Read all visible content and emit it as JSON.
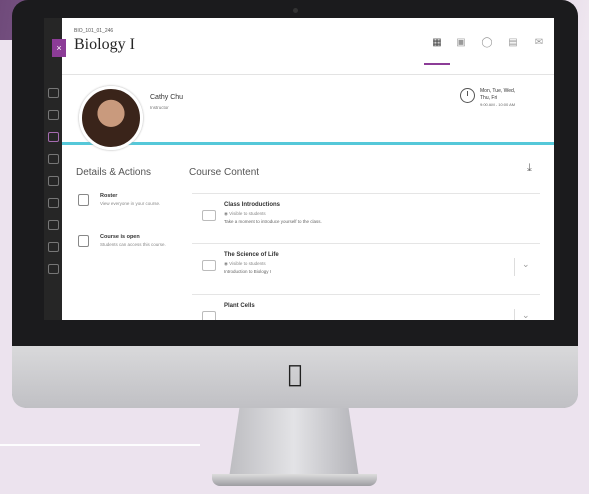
{
  "course": {
    "id": "BIO_101_01_246",
    "title": "Biology I"
  },
  "nav": {
    "close_label": "×"
  },
  "header_icons": [
    "book-icon",
    "calendar-icon",
    "chat-icon",
    "grades-icon",
    "messages-icon"
  ],
  "instructor": {
    "name": "Cathy Chu",
    "role": "Instructor"
  },
  "schedule": {
    "days_line1": "Mon, Tue, Wed,",
    "days_line2": "Thu, Fri",
    "time": "9:00 AM - 10:00 AM"
  },
  "details": {
    "title": "Details & Actions",
    "items": [
      {
        "title": "Roster",
        "desc": "View everyone in your course."
      },
      {
        "title": "Course is open",
        "desc": "Students can access this course."
      }
    ]
  },
  "content": {
    "title": "Course Content",
    "items": [
      {
        "title": "Class Introductions",
        "visibility": "Visible to students",
        "desc": "Take a moment to introduce yourself to the class."
      },
      {
        "title": "The Science of Life",
        "visibility": "Visible to students",
        "desc": "Introduction to Biology I"
      },
      {
        "title": "Plant Cells",
        "visibility": "",
        "desc": ""
      }
    ]
  },
  "colors": {
    "accent": "#55c8d9",
    "brand": "#8c3c97"
  }
}
